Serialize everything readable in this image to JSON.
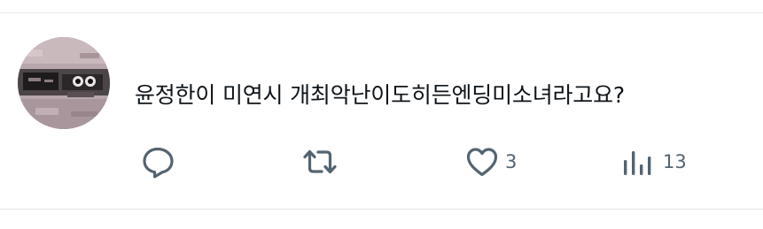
{
  "tweet": {
    "text": "윤정한이 미연시 개최악난이도히든엔딩미소녀라고요?",
    "actions": {
      "reply": {
        "icon": "reply-icon",
        "count": ""
      },
      "retweet": {
        "icon": "retweet-icon",
        "count": ""
      },
      "like": {
        "icon": "heart-icon",
        "count": "3"
      },
      "views": {
        "icon": "views-icon",
        "count": "13"
      }
    }
  },
  "colors": {
    "text": "#0f1419",
    "icon": "#536471",
    "divider": "#e6e9ec",
    "background": "#ffffff"
  }
}
